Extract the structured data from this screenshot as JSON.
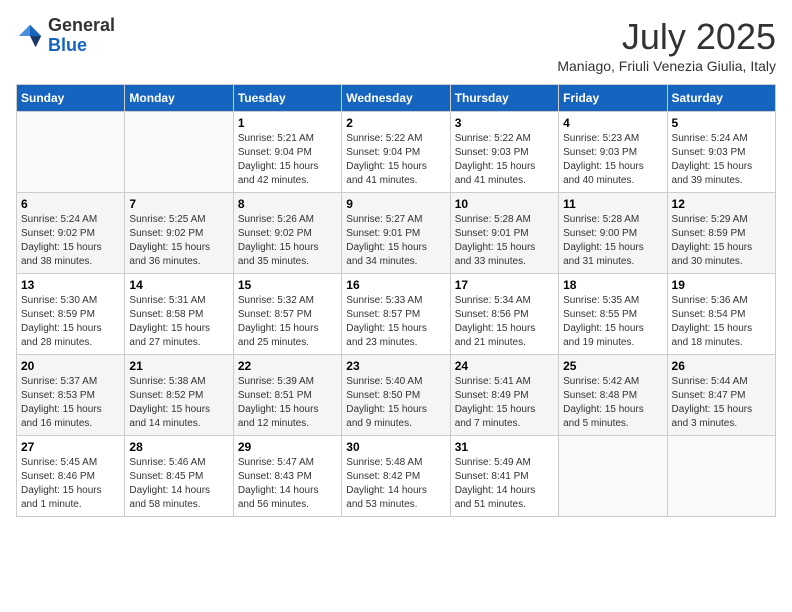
{
  "header": {
    "logo_general": "General",
    "logo_blue": "Blue",
    "month_title": "July 2025",
    "location": "Maniago, Friuli Venezia Giulia, Italy"
  },
  "weekdays": [
    "Sunday",
    "Monday",
    "Tuesday",
    "Wednesday",
    "Thursday",
    "Friday",
    "Saturday"
  ],
  "weeks": [
    [
      {
        "day": "",
        "detail": ""
      },
      {
        "day": "",
        "detail": ""
      },
      {
        "day": "1",
        "detail": "Sunrise: 5:21 AM\nSunset: 9:04 PM\nDaylight: 15 hours\nand 42 minutes."
      },
      {
        "day": "2",
        "detail": "Sunrise: 5:22 AM\nSunset: 9:04 PM\nDaylight: 15 hours\nand 41 minutes."
      },
      {
        "day": "3",
        "detail": "Sunrise: 5:22 AM\nSunset: 9:03 PM\nDaylight: 15 hours\nand 41 minutes."
      },
      {
        "day": "4",
        "detail": "Sunrise: 5:23 AM\nSunset: 9:03 PM\nDaylight: 15 hours\nand 40 minutes."
      },
      {
        "day": "5",
        "detail": "Sunrise: 5:24 AM\nSunset: 9:03 PM\nDaylight: 15 hours\nand 39 minutes."
      }
    ],
    [
      {
        "day": "6",
        "detail": "Sunrise: 5:24 AM\nSunset: 9:02 PM\nDaylight: 15 hours\nand 38 minutes."
      },
      {
        "day": "7",
        "detail": "Sunrise: 5:25 AM\nSunset: 9:02 PM\nDaylight: 15 hours\nand 36 minutes."
      },
      {
        "day": "8",
        "detail": "Sunrise: 5:26 AM\nSunset: 9:02 PM\nDaylight: 15 hours\nand 35 minutes."
      },
      {
        "day": "9",
        "detail": "Sunrise: 5:27 AM\nSunset: 9:01 PM\nDaylight: 15 hours\nand 34 minutes."
      },
      {
        "day": "10",
        "detail": "Sunrise: 5:28 AM\nSunset: 9:01 PM\nDaylight: 15 hours\nand 33 minutes."
      },
      {
        "day": "11",
        "detail": "Sunrise: 5:28 AM\nSunset: 9:00 PM\nDaylight: 15 hours\nand 31 minutes."
      },
      {
        "day": "12",
        "detail": "Sunrise: 5:29 AM\nSunset: 8:59 PM\nDaylight: 15 hours\nand 30 minutes."
      }
    ],
    [
      {
        "day": "13",
        "detail": "Sunrise: 5:30 AM\nSunset: 8:59 PM\nDaylight: 15 hours\nand 28 minutes."
      },
      {
        "day": "14",
        "detail": "Sunrise: 5:31 AM\nSunset: 8:58 PM\nDaylight: 15 hours\nand 27 minutes."
      },
      {
        "day": "15",
        "detail": "Sunrise: 5:32 AM\nSunset: 8:57 PM\nDaylight: 15 hours\nand 25 minutes."
      },
      {
        "day": "16",
        "detail": "Sunrise: 5:33 AM\nSunset: 8:57 PM\nDaylight: 15 hours\nand 23 minutes."
      },
      {
        "day": "17",
        "detail": "Sunrise: 5:34 AM\nSunset: 8:56 PM\nDaylight: 15 hours\nand 21 minutes."
      },
      {
        "day": "18",
        "detail": "Sunrise: 5:35 AM\nSunset: 8:55 PM\nDaylight: 15 hours\nand 19 minutes."
      },
      {
        "day": "19",
        "detail": "Sunrise: 5:36 AM\nSunset: 8:54 PM\nDaylight: 15 hours\nand 18 minutes."
      }
    ],
    [
      {
        "day": "20",
        "detail": "Sunrise: 5:37 AM\nSunset: 8:53 PM\nDaylight: 15 hours\nand 16 minutes."
      },
      {
        "day": "21",
        "detail": "Sunrise: 5:38 AM\nSunset: 8:52 PM\nDaylight: 15 hours\nand 14 minutes."
      },
      {
        "day": "22",
        "detail": "Sunrise: 5:39 AM\nSunset: 8:51 PM\nDaylight: 15 hours\nand 12 minutes."
      },
      {
        "day": "23",
        "detail": "Sunrise: 5:40 AM\nSunset: 8:50 PM\nDaylight: 15 hours\nand 9 minutes."
      },
      {
        "day": "24",
        "detail": "Sunrise: 5:41 AM\nSunset: 8:49 PM\nDaylight: 15 hours\nand 7 minutes."
      },
      {
        "day": "25",
        "detail": "Sunrise: 5:42 AM\nSunset: 8:48 PM\nDaylight: 15 hours\nand 5 minutes."
      },
      {
        "day": "26",
        "detail": "Sunrise: 5:44 AM\nSunset: 8:47 PM\nDaylight: 15 hours\nand 3 minutes."
      }
    ],
    [
      {
        "day": "27",
        "detail": "Sunrise: 5:45 AM\nSunset: 8:46 PM\nDaylight: 15 hours\nand 1 minute."
      },
      {
        "day": "28",
        "detail": "Sunrise: 5:46 AM\nSunset: 8:45 PM\nDaylight: 14 hours\nand 58 minutes."
      },
      {
        "day": "29",
        "detail": "Sunrise: 5:47 AM\nSunset: 8:43 PM\nDaylight: 14 hours\nand 56 minutes."
      },
      {
        "day": "30",
        "detail": "Sunrise: 5:48 AM\nSunset: 8:42 PM\nDaylight: 14 hours\nand 53 minutes."
      },
      {
        "day": "31",
        "detail": "Sunrise: 5:49 AM\nSunset: 8:41 PM\nDaylight: 14 hours\nand 51 minutes."
      },
      {
        "day": "",
        "detail": ""
      },
      {
        "day": "",
        "detail": ""
      }
    ]
  ]
}
